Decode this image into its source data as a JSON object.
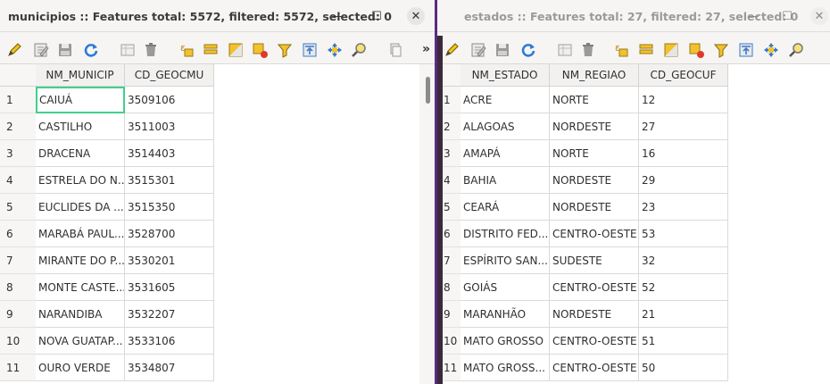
{
  "left": {
    "title": "municipios :: Features total: 5572, filtered: 5572, selected: 0",
    "columns": [
      "NM_MUNICIP",
      "CD_GEOCMU"
    ],
    "rows": [
      {
        "n": "1",
        "c": [
          "CAIUÁ",
          "3509106"
        ]
      },
      {
        "n": "2",
        "c": [
          "CASTILHO",
          "3511003"
        ]
      },
      {
        "n": "3",
        "c": [
          "DRACENA",
          "3514403"
        ]
      },
      {
        "n": "4",
        "c": [
          "ESTRELA DO N...",
          "3515301"
        ]
      },
      {
        "n": "5",
        "c": [
          "EUCLIDES DA ...",
          "3515350"
        ]
      },
      {
        "n": "6",
        "c": [
          "MARABÁ PAUL...",
          "3528700"
        ]
      },
      {
        "n": "7",
        "c": [
          "MIRANTE DO P...",
          "3530201"
        ]
      },
      {
        "n": "8",
        "c": [
          "MONTE CASTE...",
          "3531605"
        ]
      },
      {
        "n": "9",
        "c": [
          "NARANDIBA",
          "3532207"
        ]
      },
      {
        "n": "10",
        "c": [
          "NOVA GUATAP...",
          "3533106"
        ]
      },
      {
        "n": "11",
        "c": [
          "OURO VERDE",
          "3534807"
        ]
      }
    ],
    "more_label": "»"
  },
  "right": {
    "title": "estados :: Features total: 27, filtered: 27, selected: 0",
    "columns": [
      "NM_ESTADO",
      "NM_REGIAO",
      "CD_GEOCUF"
    ],
    "rows": [
      {
        "n": "1",
        "c": [
          "ACRE",
          "NORTE",
          "12"
        ]
      },
      {
        "n": "2",
        "c": [
          "ALAGOAS",
          "NORDESTE",
          "27"
        ]
      },
      {
        "n": "3",
        "c": [
          "AMAPÁ",
          "NORTE",
          "16"
        ]
      },
      {
        "n": "4",
        "c": [
          "BAHIA",
          "NORDESTE",
          "29"
        ]
      },
      {
        "n": "5",
        "c": [
          "CEARÁ",
          "NORDESTE",
          "23"
        ]
      },
      {
        "n": "6",
        "c": [
          "DISTRITO FED...",
          "CENTRO-OESTE",
          "53"
        ]
      },
      {
        "n": "7",
        "c": [
          "ESPÍRITO SAN...",
          "SUDESTE",
          "32"
        ]
      },
      {
        "n": "8",
        "c": [
          "GOIÁS",
          "CENTRO-OESTE",
          "52"
        ]
      },
      {
        "n": "9",
        "c": [
          "MARANHÃO",
          "NORDESTE",
          "21"
        ]
      },
      {
        "n": "10",
        "c": [
          "MATO GROSSO",
          "CENTRO-OESTE",
          "51"
        ]
      },
      {
        "n": "11",
        "c": [
          "MATO GROSS...",
          "CENTRO-OESTE",
          "50"
        ]
      }
    ]
  },
  "window_controls": {
    "minimize": "—",
    "maximize": "☐",
    "close": "✕"
  },
  "icons": [
    "pencil-icon",
    "edit-table-icon",
    "save-icon",
    "reload-icon",
    "add-feature-icon",
    "delete-icon",
    "expression-select-icon",
    "select-all-icon",
    "invert-selection-icon",
    "deselect-icon",
    "filter-icon",
    "move-top-icon",
    "pan-map-icon",
    "zoom-map-icon",
    "copy-icon"
  ],
  "colors": {
    "selection_border": "#3fd18a",
    "window_divider": "#5b2a86"
  }
}
